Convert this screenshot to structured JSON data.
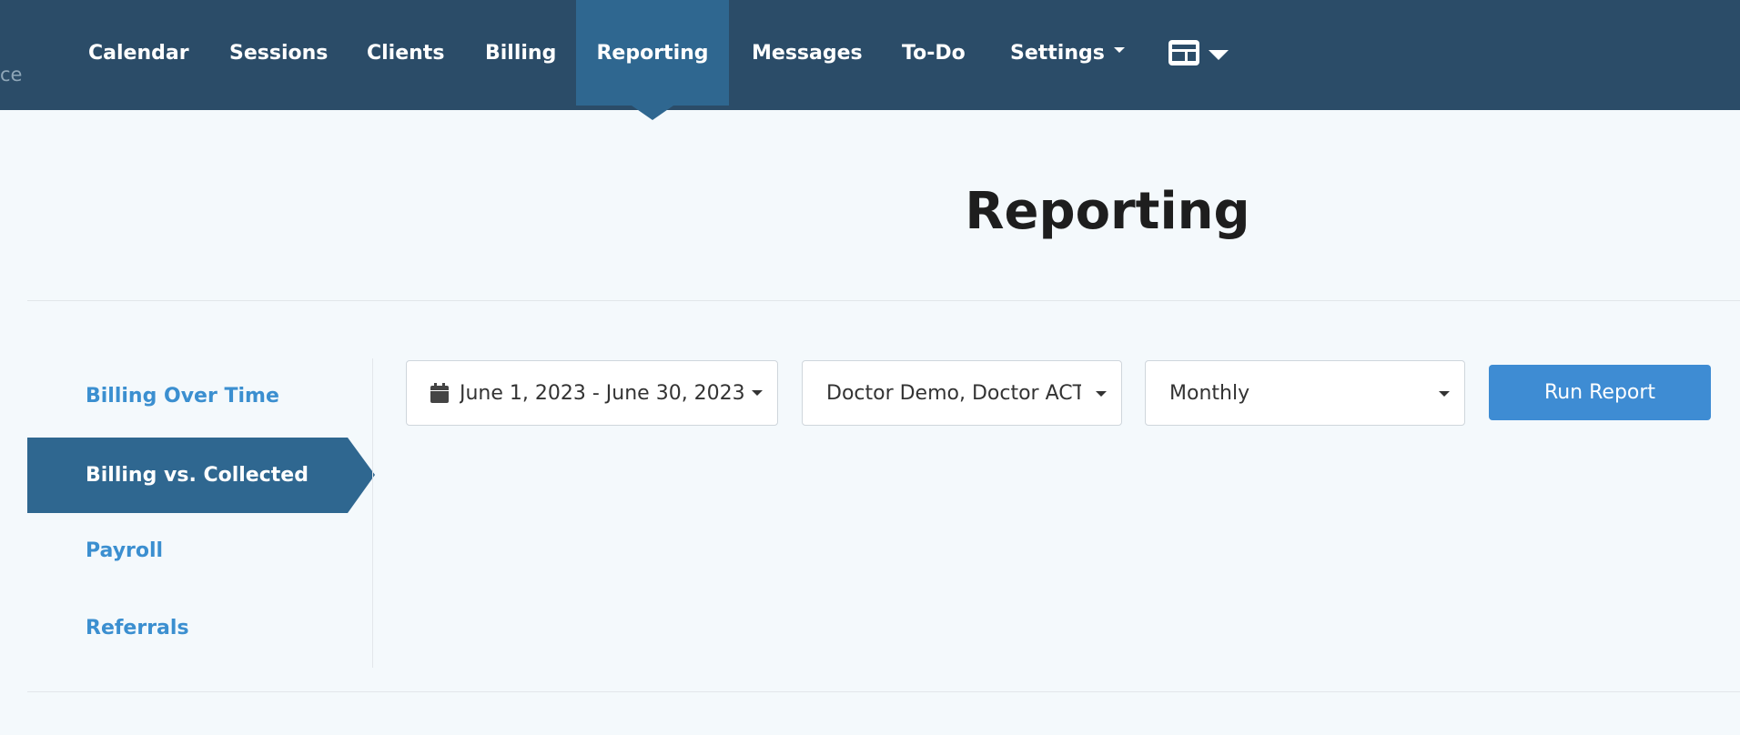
{
  "brand": {
    "fragment": "ce"
  },
  "nav": {
    "items": [
      {
        "label": "Calendar"
      },
      {
        "label": "Sessions"
      },
      {
        "label": "Clients"
      },
      {
        "label": "Billing"
      },
      {
        "label": "Reporting",
        "active": true
      },
      {
        "label": "Messages"
      },
      {
        "label": "To-Do"
      },
      {
        "label": "Settings",
        "has_dropdown": true
      }
    ],
    "layout_menu_icon": "layout-icon"
  },
  "page": {
    "title": "Reporting"
  },
  "sidebar": {
    "items": [
      {
        "label": "Billing Over Time"
      },
      {
        "label": "Billing vs. Collected",
        "active": true
      },
      {
        "label": "Payroll"
      },
      {
        "label": "Referrals"
      }
    ]
  },
  "filters": {
    "date_range": {
      "value": "June 1, 2023 - June 30, 2023",
      "icon": "calendar-icon"
    },
    "providers": {
      "value": "Doctor Demo, Doctor ACT"
    },
    "interval": {
      "value": "Monthly"
    },
    "run_label": "Run Report"
  },
  "colors": {
    "nav_bg": "#2b4c68",
    "active_bg": "#2f6790",
    "link": "#3b8fd0",
    "button": "#3e8cd3",
    "page_bg": "#f4f9fc"
  }
}
